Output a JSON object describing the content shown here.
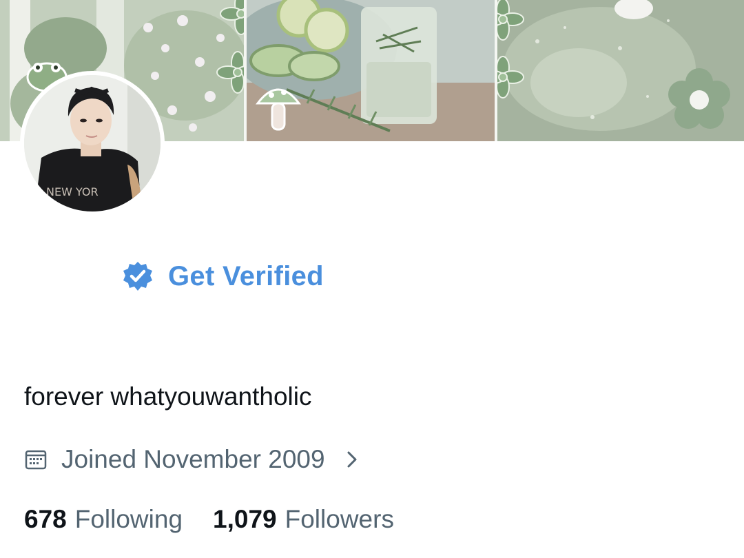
{
  "profile": {
    "verify_label": "Get Verified",
    "bio": "forever whatyouwantholic",
    "joined": "Joined November 2009",
    "stats": {
      "following_count": "678",
      "following_label": "Following",
      "followers_count": "1,079",
      "followers_label": "Followers"
    }
  },
  "icons": {
    "verify": "verified-badge-icon",
    "calendar": "calendar-icon",
    "chevron": "chevron-right-icon"
  },
  "colors": {
    "accent": "#4a8fdd",
    "text_primary": "#0f1419",
    "text_secondary": "#536471",
    "banner_green": "#8fa88c"
  }
}
